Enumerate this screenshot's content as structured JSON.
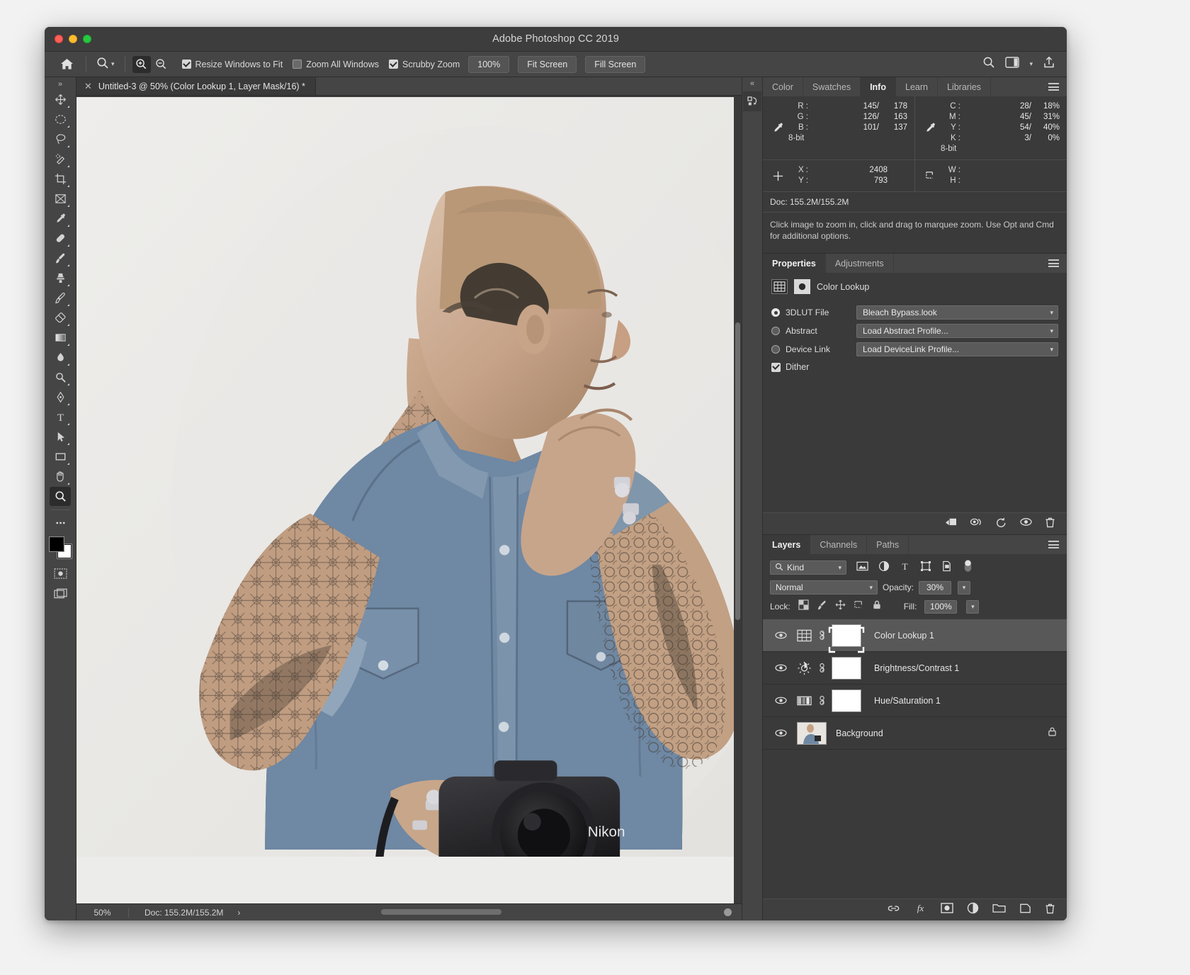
{
  "window": {
    "title": "Adobe Photoshop CC 2019"
  },
  "options_bar": {
    "home_icon": "home-icon",
    "tool_preset_icon": "zoom-tool-icon",
    "zoom_in_icon": "zoom-in-icon",
    "zoom_out_icon": "zoom-out-icon",
    "checkboxes": [
      {
        "label": "Resize Windows to Fit",
        "checked": true
      },
      {
        "label": "Zoom All Windows",
        "checked": false
      },
      {
        "label": "Scrubby Zoom",
        "checked": true
      }
    ],
    "buttons": [
      "100%",
      "Fit Screen",
      "Fill Screen"
    ],
    "right_icons": [
      "search-icon",
      "workspace-icon",
      "chevron-down-icon",
      "share-icon"
    ]
  },
  "document_tab": {
    "close_icon": "close-icon",
    "title": "Untitled‑3 @ 50% (Color Lookup 1, Layer Mask/16) *"
  },
  "toolbar": {
    "expand_label": "»",
    "tools": [
      "move-tool",
      "elliptical-marquee-tool",
      "lasso-tool",
      "quick-selection-tool",
      "crop-tool",
      "frame-tool",
      "eyedropper-tool",
      "spot-healing-brush-tool",
      "brush-tool",
      "clone-stamp-tool",
      "history-brush-tool",
      "eraser-tool",
      "gradient-tool",
      "blur-tool",
      "dodge-tool",
      "pen-tool",
      "type-tool",
      "path-selection-tool",
      "rectangle-tool",
      "hand-tool",
      "zoom-tool"
    ],
    "selected_tool": "zoom-tool",
    "more_tools_icon": "more-tools-icon",
    "edit_toolbar_icon": "edit-toolbar-icon",
    "foreground_color": "#000000",
    "background_color": "#ffffff",
    "quick_mask_icon": "quick-mask-icon",
    "screen_mode_icon": "screen-mode-icon"
  },
  "panels_top": {
    "collapse_icon": "collapse-panels-icon",
    "rail_icon": "history-snapshot-icon",
    "tabs": [
      "Color",
      "Swatches",
      "Info",
      "Learn",
      "Libraries"
    ],
    "active_tab": "Info",
    "menu_icon": "panel-menu-icon"
  },
  "info": {
    "rgb": {
      "icon": "eyedropper-icon",
      "keys": [
        "R :",
        "G :",
        "B :"
      ],
      "before": [
        "145/",
        "126/",
        "101/"
      ],
      "after": [
        "178",
        "163",
        "137"
      ],
      "depth": "8-bit"
    },
    "cmyk": {
      "icon": "eyedropper-icon",
      "keys": [
        "C :",
        "M :",
        "Y :",
        "K :"
      ],
      "before": [
        "28/",
        "45/",
        "54/",
        "3/"
      ],
      "after": [
        "18%",
        "31%",
        "40%",
        "0%"
      ],
      "depth": "8-bit"
    },
    "position": {
      "icon": "crosshair-icon",
      "keys": [
        "X :",
        "Y :"
      ],
      "values": [
        "2408",
        "793"
      ]
    },
    "dimensions": {
      "icon": "marquee-size-icon",
      "keys": [
        "W :",
        "H :"
      ],
      "values": [
        "",
        ""
      ]
    },
    "doc_size": "Doc: 155.2M/155.2M",
    "hint": "Click image to zoom in, click and drag to marquee zoom.  Use Opt and Cmd for additional options."
  },
  "properties": {
    "tabs": [
      "Properties",
      "Adjustments"
    ],
    "active_tab": "Properties",
    "menu_icon": "panel-menu-icon",
    "adjustment_icon": "color-lookup-icon",
    "mask_icon": "layer-mask-icon",
    "title": "Color Lookup",
    "options": [
      {
        "label": "3DLUT File",
        "selected": true,
        "value": "Bleach Bypass.look"
      },
      {
        "label": "Abstract",
        "selected": false,
        "value": "Load Abstract Profile..."
      },
      {
        "label": "Device Link",
        "selected": false,
        "value": "Load DeviceLink Profile..."
      }
    ],
    "dither": {
      "label": "Dither",
      "checked": true
    },
    "footer_icons": [
      "clip-to-layer-icon",
      "view-previous-state-icon",
      "reset-icon",
      "toggle-visibility-icon",
      "delete-icon"
    ]
  },
  "layers": {
    "tabs": [
      "Layers",
      "Channels",
      "Paths"
    ],
    "active_tab": "Layers",
    "menu_icon": "panel-menu-icon",
    "filter": {
      "search_icon": "search-icon",
      "kind_label": "Kind",
      "chevron": "chevron-down-icon",
      "type_icons": [
        "pixel-filter-icon",
        "adjustment-filter-icon",
        "type-filter-icon",
        "shape-filter-icon",
        "smart-object-filter-icon"
      ],
      "toggle_icon": "filter-toggle-icon"
    },
    "blend_mode": "Normal",
    "opacity_label": "Opacity:",
    "opacity_value": "30%",
    "lock_label": "Lock:",
    "lock_icons": [
      "lock-transparency-icon",
      "lock-image-icon",
      "lock-position-icon",
      "lock-artboard-icon",
      "lock-all-icon"
    ],
    "fill_label": "Fill:",
    "fill_value": "100%",
    "rows": [
      {
        "name": "Color Lookup 1",
        "visible": true,
        "selected": true,
        "adj_icon": "color-lookup-icon",
        "has_mask": true,
        "mask_selected": true,
        "locked": false
      },
      {
        "name": "Brightness/Contrast 1",
        "visible": true,
        "selected": false,
        "adj_icon": "brightness-contrast-icon",
        "has_mask": true,
        "mask_selected": false,
        "locked": false
      },
      {
        "name": "Hue/Saturation 1",
        "visible": true,
        "selected": false,
        "adj_icon": "hue-saturation-icon",
        "has_mask": true,
        "mask_selected": false,
        "locked": false
      },
      {
        "name": "Background",
        "visible": true,
        "selected": false,
        "adj_icon": "photo-thumbnail",
        "has_mask": false,
        "mask_selected": false,
        "locked": true
      }
    ],
    "footer_icons": [
      "link-layers-icon",
      "layer-style-icon",
      "add-mask-icon",
      "new-adjustment-icon",
      "new-group-icon",
      "new-layer-icon",
      "delete-layer-icon"
    ]
  },
  "status_bar": {
    "zoom": "50%",
    "doc": "Doc: 155.2M/155.2M",
    "arrow": "›"
  },
  "colors": {
    "window_chrome": "#3d3d3d",
    "panel_bg": "#3a3a3a",
    "options_bg": "#454545",
    "selected_row": "#585858",
    "text": "#dcdcdc",
    "canvas_bg": "#ececea"
  }
}
